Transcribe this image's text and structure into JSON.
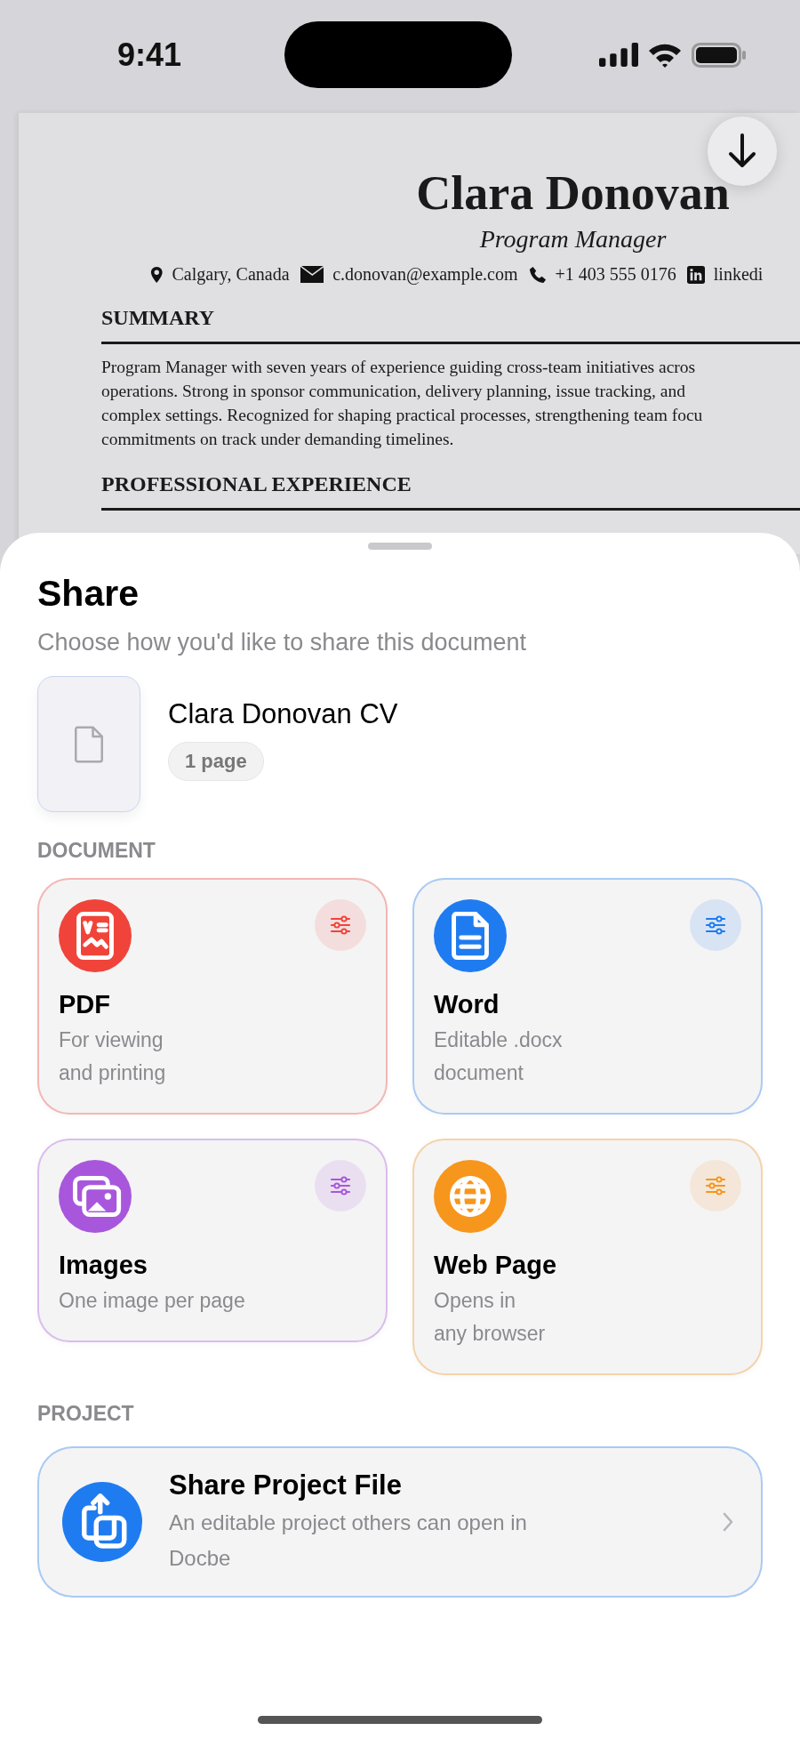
{
  "status_bar": {
    "time": "9:41"
  },
  "document": {
    "name": "Clara Donovan",
    "role": "Program Manager",
    "contacts": [
      {
        "kind": "location",
        "text": "Calgary, Canada"
      },
      {
        "kind": "email",
        "text": "c.donovan@example.com"
      },
      {
        "kind": "phone",
        "text": "+1 403 555 0176"
      },
      {
        "kind": "social",
        "text": "linkedi"
      }
    ],
    "sections": [
      {
        "heading": "SUMMARY",
        "lines": [
          "Program Manager with seven years of experience guiding cross-team initiatives acros",
          "operations. Strong in sponsor communication, delivery planning, issue tracking, and",
          "complex settings. Recognized for shaping practical processes, strengthening team focu",
          "commitments on track under demanding timelines."
        ]
      },
      {
        "heading": "PROFESSIONAL EXPERIENCE"
      }
    ]
  },
  "sheet": {
    "title": "Share",
    "subtitle": "Choose how you'd like to share this document",
    "file": {
      "name": "Clara Donovan CV",
      "pages": "1 page"
    },
    "sections": [
      {
        "label": "DOCUMENT",
        "kind": "grid",
        "options": [
          {
            "kind": "pdf",
            "label": "PDF",
            "description": "For viewing\nand printing",
            "color": "#f0443a"
          },
          {
            "kind": "word",
            "label": "Word",
            "description": "Editable .docx\ndocument",
            "color": "#1f7cf0"
          },
          {
            "kind": "images",
            "label": "Images",
            "description": "One image per page",
            "color": "#a857dc"
          },
          {
            "kind": "web",
            "label": "Web Page",
            "description": "Opens in\nany browser",
            "color": "#f7961c"
          }
        ]
      },
      {
        "label": "PROJECT",
        "kind": "list",
        "options": [
          {
            "kind": "share",
            "label": "Share Project File",
            "description": "An editable project others can open in Docbe",
            "color": "#1f7cf0"
          }
        ]
      }
    ]
  }
}
